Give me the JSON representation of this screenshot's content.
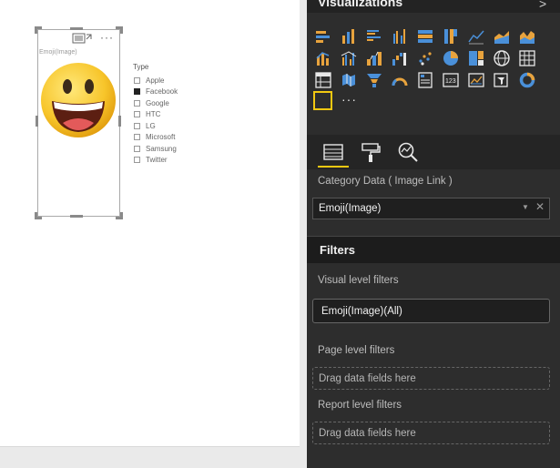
{
  "canvas": {
    "visual": {
      "title": "Emoji(Image)",
      "more_label": "···",
      "emoji_name": "grinning-face-icon"
    },
    "slicer": {
      "header": "Type",
      "items": [
        {
          "label": "Apple",
          "checked": false
        },
        {
          "label": "Facebook",
          "checked": true
        },
        {
          "label": "Google",
          "checked": false
        },
        {
          "label": "HTC",
          "checked": false
        },
        {
          "label": "LG",
          "checked": false
        },
        {
          "label": "Microsoft",
          "checked": false
        },
        {
          "label": "Samsung",
          "checked": false
        },
        {
          "label": "Twitter",
          "checked": false
        }
      ]
    }
  },
  "pane": {
    "title": "Visualizations",
    "collapse_glyph": ">",
    "more_visuals": "···",
    "visual_icons": [
      "stacked-bar-icon",
      "stacked-column-icon",
      "clustered-bar-icon",
      "clustered-column-icon",
      "100-stacked-bar-icon",
      "100-stacked-column-icon",
      "line-chart-icon",
      "area-chart-icon",
      "stacked-area-icon",
      "line-column-icon",
      "line-clustered-column-icon",
      "ribbon-chart-icon",
      "waterfall-icon",
      "scatter-icon",
      "pie-chart-icon",
      "treemap-icon",
      "globe-map-icon",
      "table-icon",
      "matrix-icon",
      "filled-map-icon",
      "funnel-icon",
      "gauge-icon",
      "multi-row-card-icon",
      "card-icon",
      "kpi-icon",
      "slicer-icon",
      "donut-icon",
      "r-visual-icon"
    ],
    "tabs": [
      "fields-tab-icon",
      "format-tab-icon",
      "analytics-tab-icon"
    ],
    "category_label": "Category Data ( Image Link )",
    "category_value": "Emoji(Image)",
    "filters": {
      "title": "Filters",
      "visual_level_label": "Visual level filters",
      "visual_filter": "Emoji(Image)(All)",
      "page_level_label": "Page level filters",
      "page_drop": "Drag data fields here",
      "report_level_label": "Report level filters",
      "report_drop": "Drag data fields here"
    },
    "colors": {
      "accent": "#f2c811",
      "icon_orange": "#e8a33d",
      "icon_blue": "#4a90d9"
    }
  }
}
